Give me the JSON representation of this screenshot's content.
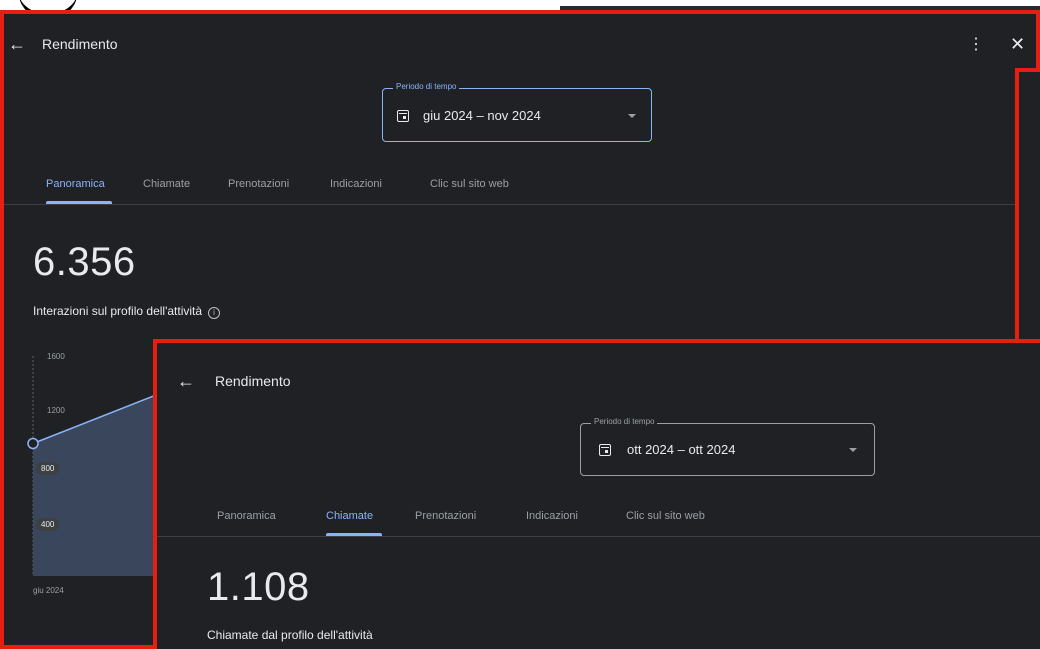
{
  "back_window": {
    "title": "Rendimento",
    "period": {
      "legend": "Periodo di tempo",
      "value": "giu 2024 – nov 2024"
    },
    "tabs": [
      {
        "label": "Panoramica",
        "active": true
      },
      {
        "label": "Chiamate",
        "active": false
      },
      {
        "label": "Prenotazioni",
        "active": false
      },
      {
        "label": "Indicazioni",
        "active": false
      },
      {
        "label": "Clic sul sito web",
        "active": false
      }
    ],
    "metric": {
      "value": "6.356",
      "label": "Interazioni sul profilo dell'attività"
    },
    "icons": {
      "back": "arrow-left-icon",
      "menu": "more-vert-icon",
      "close": "close-icon",
      "info": "info-icon",
      "calendar": "calendar-icon"
    },
    "chart": {
      "y_ticks": [
        "1600",
        "1200",
        "800",
        "400"
      ],
      "x_ticks": [
        "giu 2024"
      ]
    }
  },
  "front_window": {
    "title": "Rendimento",
    "period": {
      "legend": "Periodo di tempo",
      "value": "ott 2024 – ott 2024"
    },
    "tabs": [
      {
        "label": "Panoramica",
        "active": false
      },
      {
        "label": "Chiamate",
        "active": true
      },
      {
        "label": "Prenotazioni",
        "active": false
      },
      {
        "label": "Indicazioni",
        "active": false
      },
      {
        "label": "Clic sul sito web",
        "active": false
      }
    ],
    "metric": {
      "value": "1.108",
      "label": "Chiamate dal profilo dell'attività"
    }
  },
  "chart_data": {
    "type": "area",
    "x": [
      "giu 2024"
    ],
    "series": [
      {
        "values": [
          1000
        ]
      }
    ],
    "ylim": [
      0,
      1600
    ]
  },
  "colors": {
    "highlight_border": "#e81e12",
    "accent": "#8ab4f8",
    "background": "#202124"
  }
}
